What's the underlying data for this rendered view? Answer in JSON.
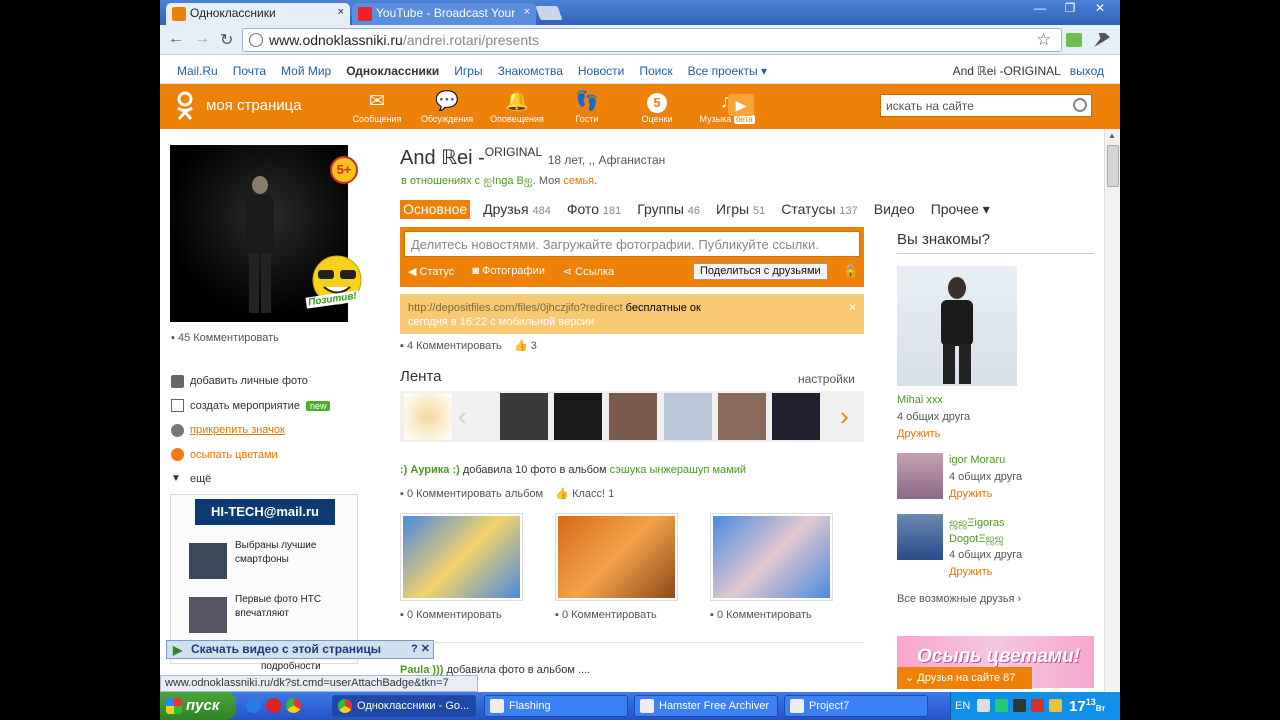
{
  "browser": {
    "tabs": [
      {
        "title": "Одноклассники",
        "close": "×"
      },
      {
        "title": "YouTube - Broadcast Your",
        "close": "×"
      }
    ],
    "window_buttons": [
      "—",
      "❐",
      "✕"
    ],
    "url_host": "www.odnoklassniki.ru",
    "url_path": "/andrei.rotari/presents",
    "nav": {
      "back": "←",
      "forward": "→",
      "reload": "↻",
      "star": "☆"
    }
  },
  "mailbar": {
    "links": [
      "Mail.Ru",
      "Почта",
      "Мой Мир",
      "Одноклассники",
      "Игры",
      "Знакомства",
      "Новости",
      "Поиск",
      "Все проекты ▾"
    ],
    "current_index": 3,
    "user": "And ℝei -ORIGINAL",
    "logout": "выход"
  },
  "header": {
    "my_page": "моя страница",
    "nav": [
      {
        "label": "Сообщения",
        "icon": "envelope-icon",
        "glyph": "✉"
      },
      {
        "label": "Обсуждения",
        "icon": "speech-bubbles-icon",
        "glyph": "💬"
      },
      {
        "label": "Оповещения",
        "icon": "bell-icon",
        "glyph": "🔔"
      },
      {
        "label": "Гости",
        "icon": "footprints-icon",
        "glyph": "👣"
      },
      {
        "label": "Оценки",
        "icon": "rating-5-icon",
        "glyph": "5"
      },
      {
        "label": "Музыка",
        "icon": "music-note-icon",
        "glyph": "♫",
        "badge": "бета"
      }
    ],
    "play": "▶",
    "search_placeholder": "искать на сайте"
  },
  "profile": {
    "name": "And ℝei -",
    "name_sup": "ORIGINAL",
    "age_loc": "18 лет, ,, Афганистан",
    "relation_prefix": "в отношениях с",
    "relation_partner": "ஐInga Bஐ",
    "family_prefix": ". Моя",
    "family_link": "семья",
    "family_suffix": ".",
    "avatar_badge": "5+",
    "pozitiv": "Позитив!",
    "comments": "45 Комментировать",
    "actions": [
      {
        "label": "добавить личные фото",
        "icon": "camera-icon",
        "link": false
      },
      {
        "label": "создать мероприятие",
        "icon": "calendar-icon",
        "link": false,
        "badge": "new"
      },
      {
        "label": "прикрепить значок",
        "icon": "star-badge-icon",
        "link": true
      },
      {
        "label": "осыпать цветами",
        "icon": "flower-icon",
        "link": true
      },
      {
        "label": "ещё",
        "icon": "triangle-down-icon",
        "link": false
      }
    ]
  },
  "tabs": [
    {
      "label": "Основное",
      "count": ""
    },
    {
      "label": "Друзья",
      "count": "484"
    },
    {
      "label": "Фото",
      "count": "181"
    },
    {
      "label": "Группы",
      "count": "46"
    },
    {
      "label": "Игры",
      "count": "51"
    },
    {
      "label": "Статусы",
      "count": "137"
    },
    {
      "label": "Видео",
      "count": ""
    },
    {
      "label": "Прочее ▾",
      "count": ""
    }
  ],
  "postbox": {
    "placeholder": "Делитесь новостями. Загружайте фотографии. Публикуйте ссылки.",
    "opts": [
      "Статус",
      "Фотографии",
      "Ссылка"
    ],
    "share": "Поделиться с друзьями"
  },
  "notice": {
    "url": "http://depositfiles.com/files/0jhczjifo?redirect",
    "text": " бесплатные ок",
    "time": "сегодня в 16:22  с мобильной версии",
    "close": "×"
  },
  "post_footer": {
    "comments": "4 Комментировать",
    "likes": "3"
  },
  "feed": {
    "title": "Лента",
    "settings": "настройки",
    "item1_user": ":) Аурика :)",
    "item1_text": " добавила 10 фото в альбом ",
    "item1_album": "сэшука ынжерашуп мамий",
    "item1_comments": "0 Комментировать альбом",
    "item1_class": "Класс! 1",
    "photo_comments": [
      "0 Комментировать",
      "0 Комментировать",
      "0 Комментировать"
    ],
    "item2_user": "Paula )))",
    "item2_text": " добавила фото в альбом ...."
  },
  "right": {
    "title": "Вы знакомы?",
    "people": [
      {
        "name": "Mihai xxx",
        "info": "4 общих друга",
        "add": "Дружить"
      },
      {
        "name": "igor Moraru",
        "info": "4 общих друга",
        "add": "Дружить"
      },
      {
        "name": "ஜஜΞigoras DogotΞஜஜ",
        "info": "4 общих друга",
        "add": "Дружить"
      }
    ],
    "all_friends": "Все возможные друзья ›",
    "flowers": "Осыпь цветами!",
    "friends_online": "Друзья на сайте 87"
  },
  "left_ads": {
    "brand": "HI-TECH@mail.ru",
    "items": [
      "Выбраны лучшие смартфоны",
      "Первые фото HTC впечатляют"
    ],
    "more": "подробности"
  },
  "download_bar": {
    "label": "Скачать видео с этой страницы",
    "help": "?",
    "close": "✕"
  },
  "status_url": "www.odnoklassniki.ru/dk?st.cmd=userAttachBadge&tkn=7",
  "taskbar": {
    "start": "пуск",
    "tasks": [
      "Одноклассники - Go...",
      "Flashing",
      "Hamster Free Archiver",
      "Project7"
    ],
    "lang": "EN",
    "time": "17",
    "time_min": "13",
    "day": "Вт"
  }
}
